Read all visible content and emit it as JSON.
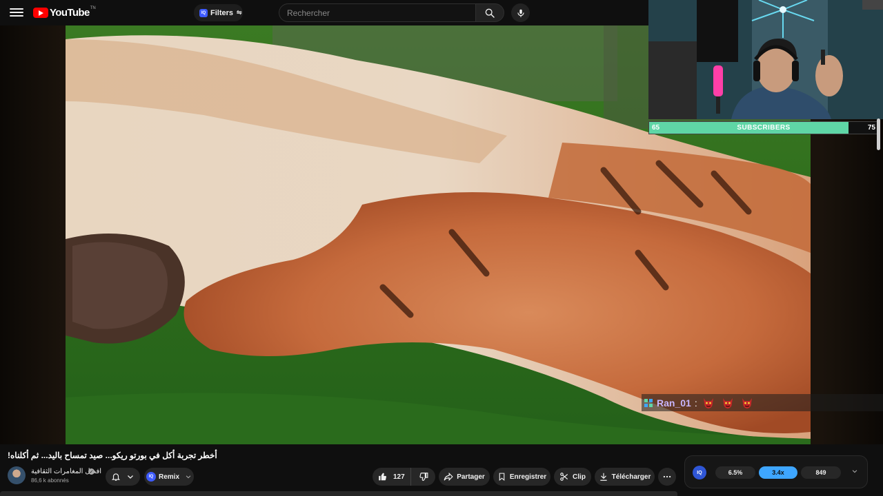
{
  "header": {
    "menu_icon": "hamburger-menu-icon",
    "logo_text": "YouTube",
    "logo_sup": "TN",
    "filters_label": "Filters",
    "search_placeholder": "Rechercher",
    "search_icon": "search-icon",
    "mic_icon": "microphone-icon"
  },
  "stream_overlay": {
    "subscriber_goal": {
      "start": "65",
      "label": "SUBSCRIBERS",
      "end": "75",
      "progress": 0.87,
      "fill_color": "#5fd6a6"
    },
    "chat": {
      "username": "Ran_01",
      "separator": ":",
      "emote_count": 3,
      "emote_name": "red-demon-emote"
    }
  },
  "video": {
    "title": "أخطر تجربة أكل في بورتو ريكو... صيد تمساح باليد... ثم أكلناه!",
    "channel_name": "افضل المغامرات الثقافية",
    "subscribers": "86,6 k abonnés",
    "remix_label": "Remix"
  },
  "actions": {
    "like_count": "127",
    "share_label": "Partager",
    "save_label": "Enregistrer",
    "clip_label": "Clip",
    "download_label": "Télécharger"
  },
  "iq_panel": {
    "logo": "IQ",
    "stats": [
      "6.5%",
      "3.4x",
      "849"
    ],
    "active_index": 1,
    "accent_color": "#3ea6ff"
  }
}
